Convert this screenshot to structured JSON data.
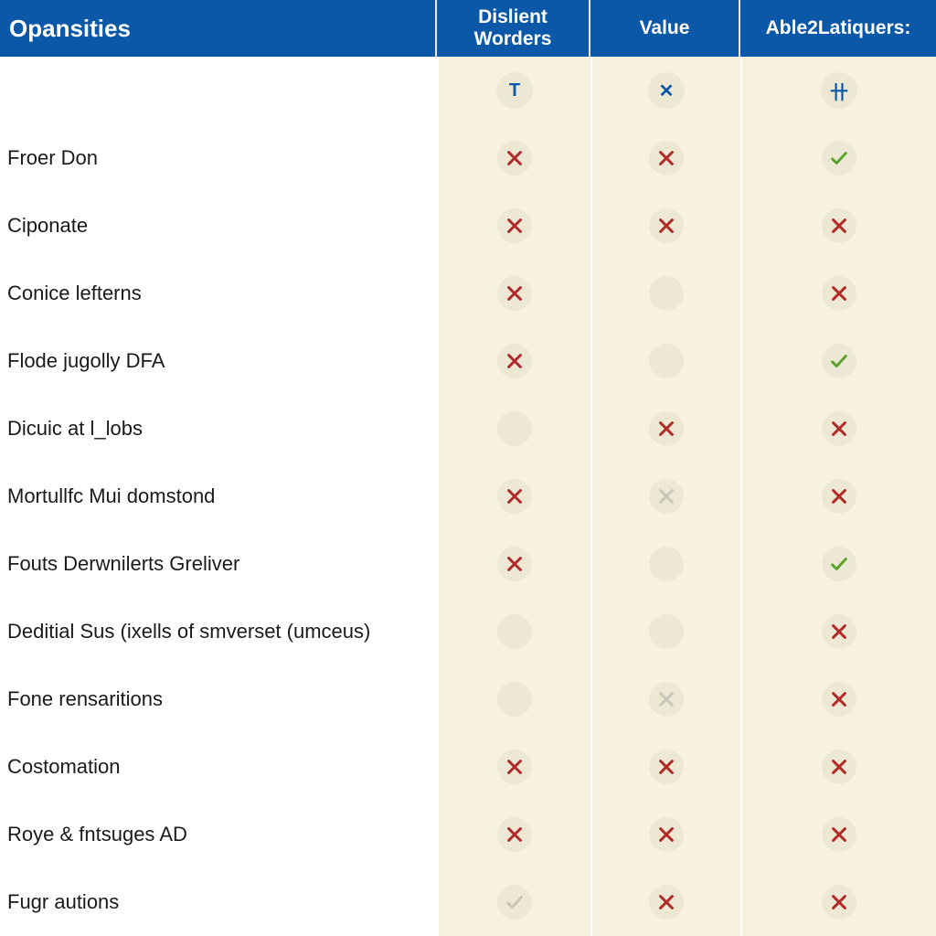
{
  "header": {
    "feature_col": "Opansities",
    "columns": [
      "Dislient\nWorders",
      "Value",
      "Able2Latiquers:"
    ],
    "header_glyphs": [
      "T",
      "✕",
      "卄"
    ]
  },
  "rows": [
    {
      "label": "",
      "cells": [
        "hdr0",
        "hdr1",
        "hdr2"
      ]
    },
    {
      "label": "Froer Don",
      "cells": [
        "cross",
        "cross",
        "check"
      ]
    },
    {
      "label": "Ciponate",
      "cells": [
        "cross",
        "cross",
        "cross"
      ]
    },
    {
      "label": "Conice lefterns",
      "cells": [
        "cross",
        "empty",
        "cross"
      ]
    },
    {
      "label": "Flode jugolly DFA",
      "cells": [
        "cross",
        "empty",
        "check"
      ]
    },
    {
      "label": "Dicuic at l_lobs",
      "cells": [
        "empty",
        "cross",
        "cross"
      ]
    },
    {
      "label": "Mortullfc Mui domstond",
      "cells": [
        "cross",
        "faded",
        "cross"
      ]
    },
    {
      "label": "Fouts Derwnilerts Greliver",
      "cells": [
        "cross",
        "empty",
        "check"
      ]
    },
    {
      "label": "Deditial Sus (ixells of smverset (umceus)",
      "cells": [
        "empty",
        "empty",
        "cross"
      ]
    },
    {
      "label": "Fone rensaritions",
      "cells": [
        "empty",
        "faded",
        "cross"
      ]
    },
    {
      "label": "Costomation",
      "cells": [
        "cross",
        "cross",
        "cross"
      ]
    },
    {
      "label": "Roye & fntsuges AD",
      "cells": [
        "cross",
        "cross",
        "cross"
      ]
    },
    {
      "label": "Fugr autions",
      "cells": [
        "faded-check",
        "cross",
        "cross"
      ]
    }
  ],
  "icon_names": {
    "check": "check-icon",
    "cross": "cross-icon",
    "faded": "cross-faded-icon",
    "faded-check": "check-faded-icon",
    "empty": "empty-icon"
  }
}
